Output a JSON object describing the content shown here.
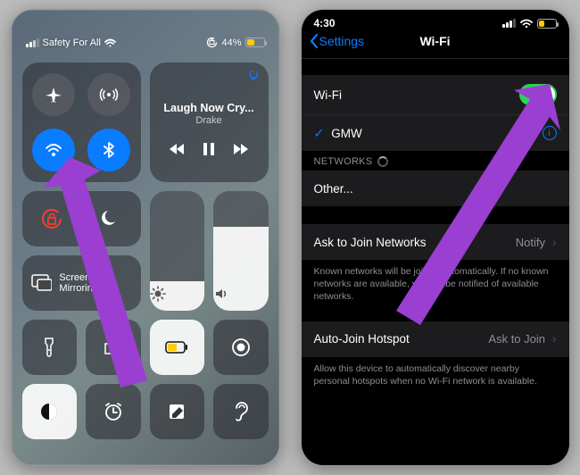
{
  "cc": {
    "carrier": "Safety For All",
    "battery_pct": "44%",
    "media_title": "Laugh Now Cry...",
    "media_artist": "Drake",
    "mirroring_label": "Screen Mirroring",
    "brightness_pct": 25,
    "volume_pct": 70
  },
  "settings": {
    "time": "4:30",
    "back_label": "Settings",
    "title": "Wi-Fi",
    "wifi_row_label": "Wi-Fi",
    "wifi_on": true,
    "connected_network": "GMW",
    "networks_header": "NETWORKS",
    "other_label": "Other...",
    "join_label": "Ask to Join Networks",
    "join_value": "Notify",
    "join_blurb": "Known networks will be joined automatically. If no known networks are available, you will be notified of available networks.",
    "hotspot_label": "Auto-Join Hotspot",
    "hotspot_value": "Ask to Join",
    "hotspot_blurb": "Allow this device to automatically discover nearby personal hotspots when no Wi-Fi network is available.",
    "battery_level": 30,
    "battery_color": "#ffcc00"
  },
  "arrow_color": "#9a3fd1"
}
